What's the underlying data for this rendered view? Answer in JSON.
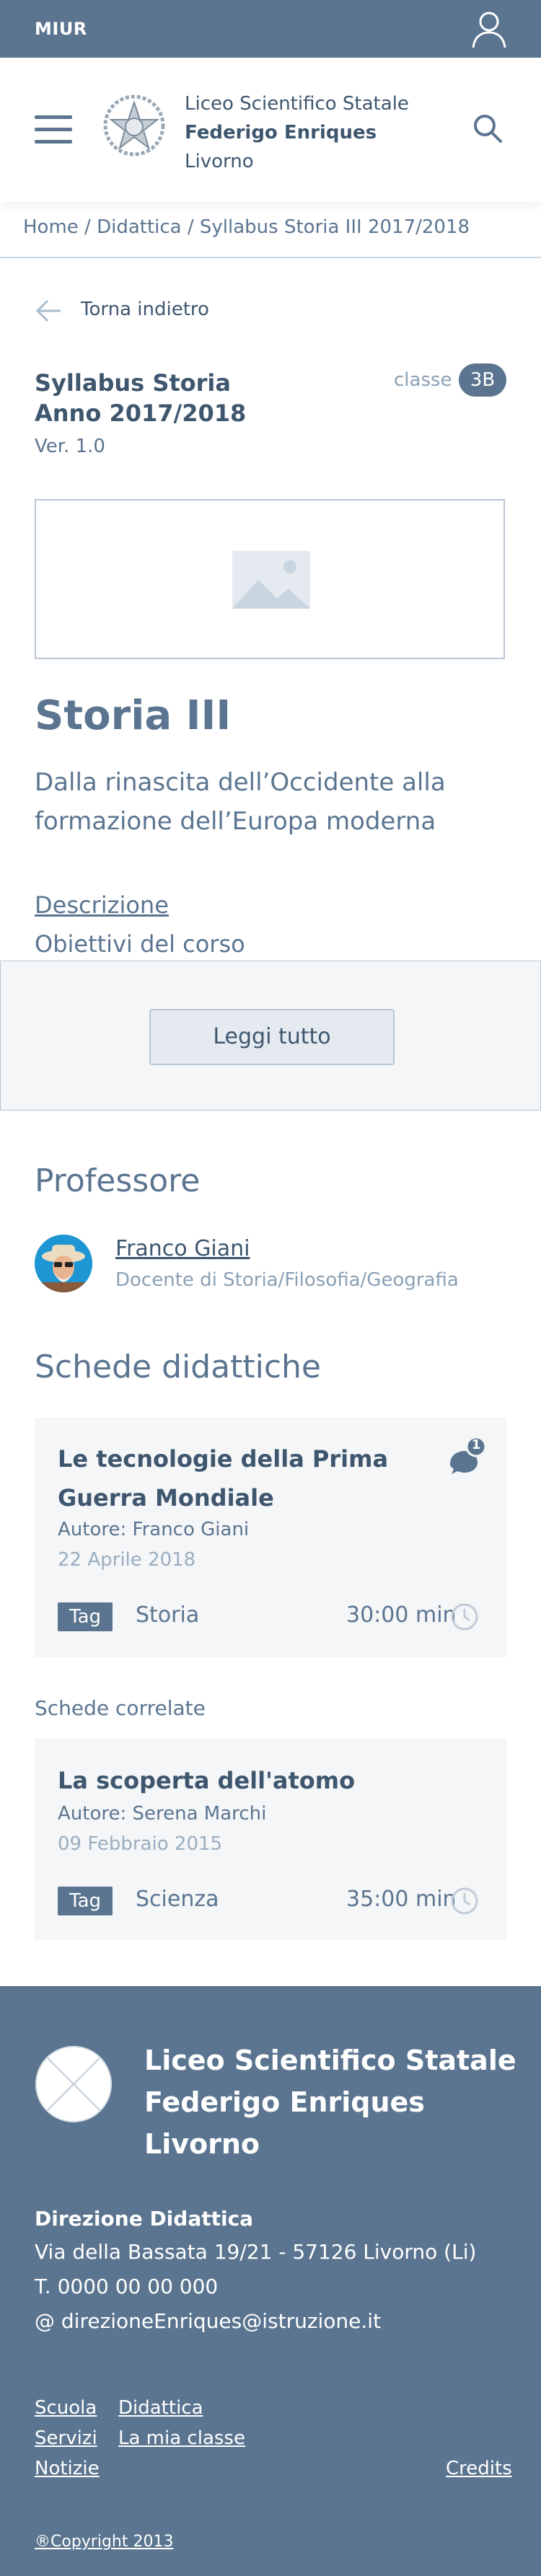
{
  "topbar": {
    "brand": "MIUR",
    "icon": "user-icon"
  },
  "header": {
    "menu_icon": "hamburger-icon",
    "emblem_icon": "emblem-icon",
    "school_line1": "Liceo Scientifico Statale",
    "school_line2": "Federigo Enriques",
    "school_line3": "Livorno",
    "search_icon": "search-icon"
  },
  "breadcrumb": {
    "home": "Home",
    "sep": " / ",
    "section": "Didattica",
    "current": "Syllabus Storia III 2017/2018"
  },
  "back": {
    "label": "Torna indietro",
    "icon": "arrow-left-icon"
  },
  "syllabus": {
    "title_line1": "Syllabus Storia",
    "title_line2": "Anno 2017/2018",
    "version": "Ver. 1.0",
    "class_label": "classe",
    "class_value": "3B"
  },
  "course": {
    "title": "Storia III",
    "subtitle": "Dalla rinascita dell’Occidente alla formazione dell’Europa moderna",
    "link_description": "Descrizione",
    "link_objectives": "Obiettivi del corso",
    "read_more": "Leggi tutto"
  },
  "professor": {
    "heading": "Professore",
    "name": "Franco Giani",
    "role": "Docente di Storia/Filosofia/Geografia"
  },
  "schede": {
    "heading": "Schede didattiche",
    "cards": [
      {
        "title": "Le tecnologie della Prima Guerra Mondiale",
        "author_label": "Autore:",
        "author": "Franco Giani",
        "date": "22 Aprile 2018",
        "tag": "Tag",
        "topic": "Storia",
        "duration": "30:00 min",
        "comments": "1"
      }
    ],
    "related_label": "Schede correlate",
    "related": [
      {
        "title": "La scoperta dell'atomo",
        "author_label": "Autore:",
        "author": "Serena Marchi",
        "date": "09 Febbraio 2015",
        "tag": "Tag",
        "topic": "Scienza",
        "duration": "35:00 min"
      }
    ]
  },
  "footer": {
    "name": "Liceo Scientifico Statale Federigo Enriques Livorno",
    "direzione": "Direzione Didattica",
    "address": "Via della Bassata 19/21 - 57126 Livorno (Li)",
    "phone": "T. 0000 00 00 000",
    "email": "@ direzioneEnriques@istruzione.it",
    "links": [
      "Scuola",
      "Didattica",
      "Servizi",
      "La mia classe",
      "Notizie"
    ],
    "credits": "Credits",
    "copyright": "®Copyright 2013"
  },
  "colors": {
    "primary": "#5b7590",
    "text_dark": "#3e566e",
    "card_bg": "#f4f6f8",
    "border": "#b9c6d2"
  }
}
